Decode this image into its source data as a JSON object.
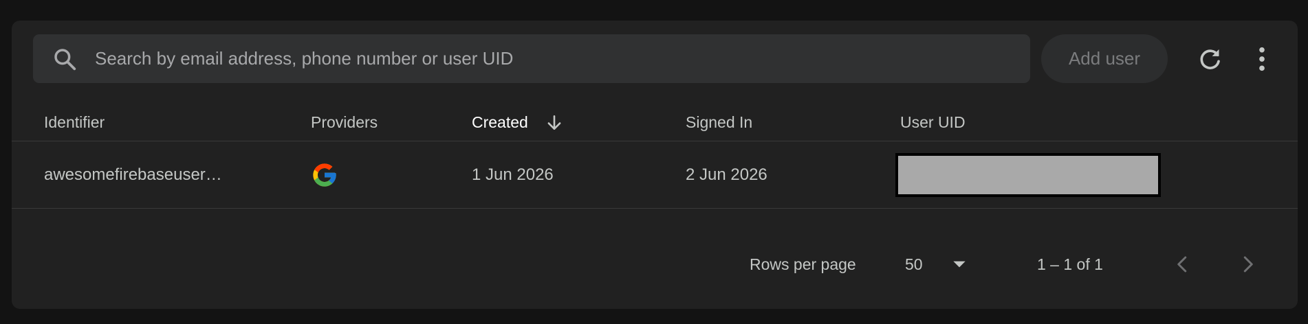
{
  "colors": {
    "page_background": "#131313",
    "card_background": "#212121",
    "search_background": "#303132",
    "text_primary": "#c4c7c5",
    "text_active": "#ffffff",
    "text_muted": "#7b7c7e",
    "divider": "#3a3a3a",
    "redaction_fill": "#a9a9a9"
  },
  "toolbar": {
    "search_icon": "search-icon",
    "search_placeholder": "Search by email address, phone number or user UID",
    "search_value": "",
    "add_user_label": "Add user",
    "refresh_icon": "refresh-icon",
    "more_icon": "more-vert-icon"
  },
  "table": {
    "columns": [
      {
        "label": "Identifier"
      },
      {
        "label": "Providers"
      },
      {
        "label": "Created",
        "sorted": "descending",
        "sort_icon": "arrow-down-icon"
      },
      {
        "label": "Signed In"
      },
      {
        "label": "User UID"
      }
    ],
    "rows": [
      {
        "identifier": "awesomefirebaseuser…",
        "provider_icon": "google-icon",
        "created": "1 Jun 2026",
        "signed_in": "2 Jun 2026",
        "user_uid": "redacted"
      }
    ]
  },
  "pagination": {
    "rows_per_page_label": "Rows per page",
    "rows_per_page_value": "50",
    "dropdown_icon": "dropdown-arrow-icon",
    "range_label": "1 – 1 of 1",
    "prev_icon": "chevron-left-icon",
    "next_icon": "chevron-right-icon"
  }
}
